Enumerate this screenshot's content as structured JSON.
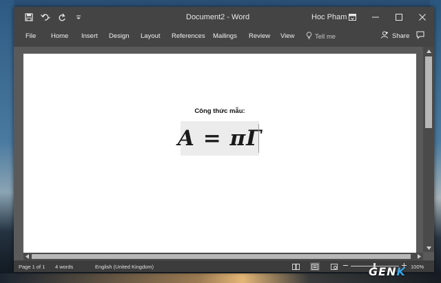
{
  "window": {
    "title": "Document2  -  Word",
    "user": "Hoc Pham",
    "controls": [
      "ribbon-display-icon",
      "minimize-icon",
      "maximize-icon",
      "close-icon"
    ]
  },
  "quick_access": [
    "save-icon",
    "undo-icon",
    "redo-icon",
    "customize-icon"
  ],
  "ribbon": {
    "tabs": [
      "File",
      "Home",
      "Insert",
      "Design",
      "Layout",
      "References",
      "Mailings",
      "Review",
      "View"
    ],
    "tell_me": "Tell me",
    "share": "Share"
  },
  "document": {
    "heading": "Công thức mẫu:",
    "equation": "A = πΓ"
  },
  "status_bar": {
    "page": "Page 1 of 1",
    "words": "4 words",
    "language": "English (United Kingdom)",
    "zoom": "100%"
  },
  "watermark": {
    "main": "GEN",
    "accent": "K"
  },
  "colors": {
    "window": "#444444",
    "document_bg": "#5a5a5a",
    "page": "#ffffff",
    "equation_bg": "#ececec"
  }
}
